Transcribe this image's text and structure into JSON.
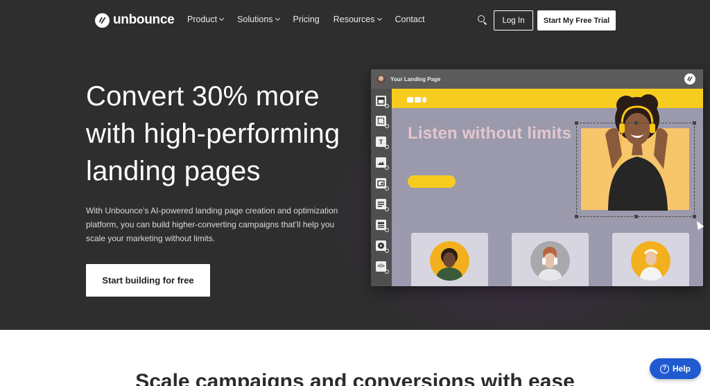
{
  "brand": {
    "name": "unbounce"
  },
  "nav": {
    "items": [
      {
        "label": "Product",
        "has_dropdown": true
      },
      {
        "label": "Solutions",
        "has_dropdown": true
      },
      {
        "label": "Pricing",
        "has_dropdown": false
      },
      {
        "label": "Resources",
        "has_dropdown": true
      },
      {
        "label": "Contact",
        "has_dropdown": false
      }
    ],
    "login_label": "Log In",
    "trial_label": "Start My Free Trial"
  },
  "hero": {
    "headline": "Convert 30% more with high-performing landing pages",
    "subtext": "With Unbounce’s AI-powered landing page creation and optimization platform, you can build higher-converting campaigns that’ll help you scale your marketing without limits.",
    "cta_label": "Start building for free"
  },
  "editor": {
    "window_title": "Your Landing Page",
    "canvas_headline": "Listen without limits",
    "tools": [
      "section-icon",
      "box-icon",
      "text-icon",
      "image-icon",
      "form-icon",
      "paragraph-icon",
      "list-icon",
      "video-icon",
      "code-icon"
    ]
  },
  "section": {
    "title": "Scale campaigns and conversions with ease"
  },
  "help": {
    "label": "Help"
  },
  "colors": {
    "hero_bg": "#2e2e2e",
    "accent_yellow": "#f6cc1f",
    "canvas_purple": "#9b99ac",
    "headline_pink": "#e2c7cd",
    "help_blue": "#1f5ad1"
  }
}
